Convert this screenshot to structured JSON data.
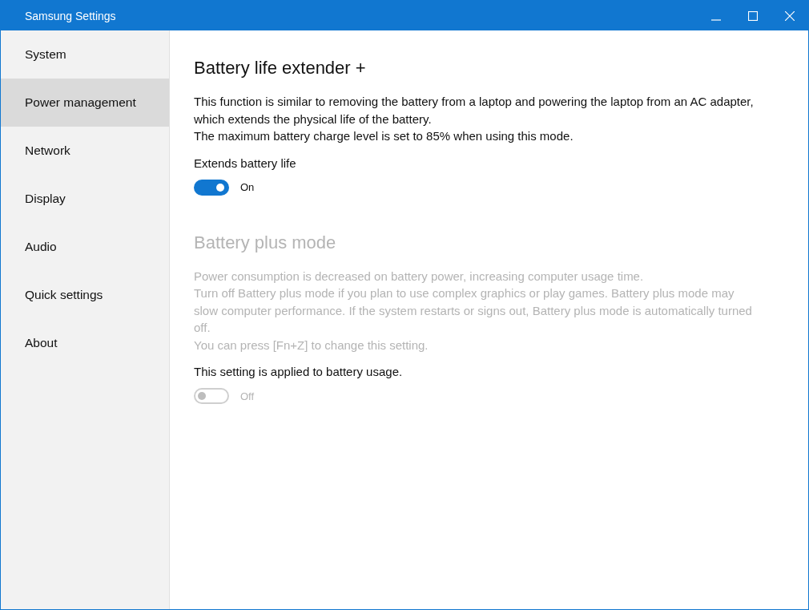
{
  "window": {
    "title": "Samsung Settings"
  },
  "sidebar": {
    "items": [
      {
        "label": "System",
        "selected": false
      },
      {
        "label": "Power management",
        "selected": true
      },
      {
        "label": "Network",
        "selected": false
      },
      {
        "label": "Display",
        "selected": false
      },
      {
        "label": "Audio",
        "selected": false
      },
      {
        "label": "Quick settings",
        "selected": false
      },
      {
        "label": "About",
        "selected": false
      }
    ]
  },
  "sections": [
    {
      "title": "Battery life extender +",
      "disabled": false,
      "paragraphs": [
        "This function is similar to removing the battery from a laptop and powering the laptop from an AC adapter, which extends the physical life of the battery.",
        "The maximum battery charge level is set to 85% when using this mode."
      ],
      "setting_label": "Extends battery life",
      "toggle": {
        "on": true,
        "disabled": false,
        "label": "On"
      }
    },
    {
      "title": "Battery plus mode",
      "disabled": true,
      "paragraphs": [
        "Power consumption is decreased on battery power, increasing computer usage time.",
        "Turn off Battery plus mode if you plan to use complex graphics or play games. Battery plus mode may slow computer performance. If the system restarts or signs out, Battery plus mode is automatically turned off.",
        "You can press [Fn+Z] to change this setting."
      ],
      "setting_label": "This setting is applied to battery usage.",
      "toggle": {
        "on": false,
        "disabled": true,
        "label": "Off"
      }
    }
  ]
}
